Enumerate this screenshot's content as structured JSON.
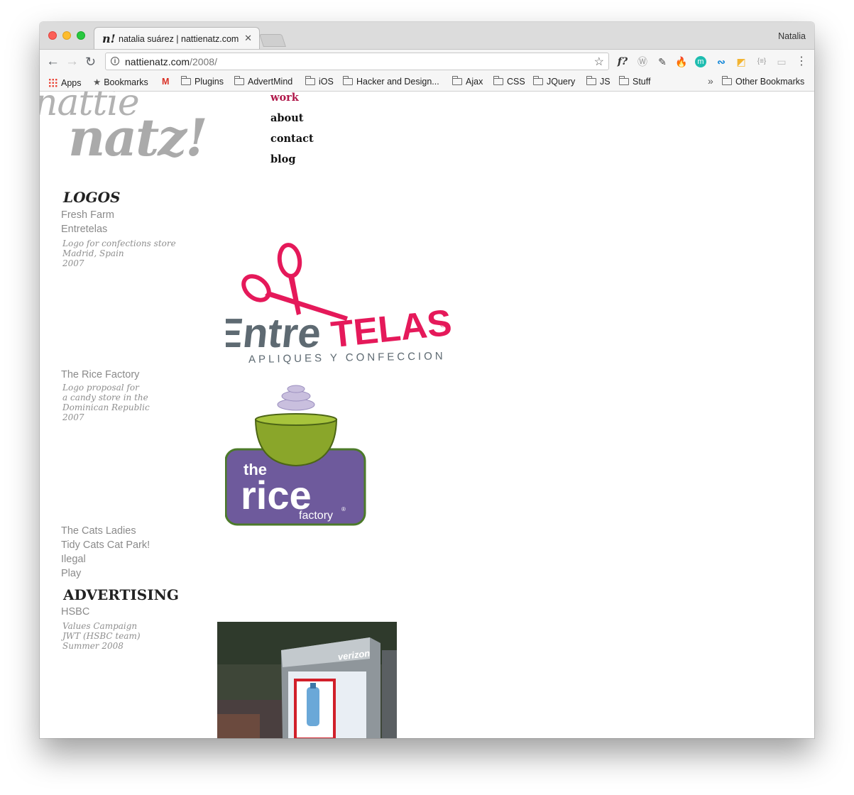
{
  "browser": {
    "tab_favicon": "n!",
    "tab_title": "natalia suárez | nattienatz.com",
    "tab_close": "✕",
    "profile_name": "Natalia",
    "url_host": "nattienatz.com",
    "url_path": "/2008/",
    "info_icon": "i",
    "star_icon": "☆",
    "back_icon": "←",
    "forward_icon": "→",
    "reload_icon": "↻",
    "extensions": [
      {
        "name": "whatfont-icon",
        "glyph": "f?"
      },
      {
        "name": "wordpress-icon",
        "glyph": "Ⓦ"
      },
      {
        "name": "eyedropper-icon",
        "glyph": "✎"
      },
      {
        "name": "fire-icon",
        "glyph": "🔥"
      },
      {
        "name": "m-extension-icon",
        "glyph": "m"
      },
      {
        "name": "wave-icon",
        "glyph": "∾"
      },
      {
        "name": "highlighter-icon",
        "glyph": "◩"
      },
      {
        "name": "json-icon",
        "glyph": "{≡}"
      },
      {
        "name": "toggle-icon",
        "glyph": "▭"
      },
      {
        "name": "menu-icon",
        "glyph": "⋮"
      }
    ]
  },
  "bookmarks": {
    "apps": "Apps",
    "bookmarks": "Bookmarks",
    "gmail": "M",
    "folders": [
      "Plugins",
      "AdvertMind",
      "iOS",
      "Hacker and Design...",
      "Ajax",
      "CSS",
      "JQuery",
      "JS",
      "Stuff"
    ],
    "overflow": "»",
    "other": "Other Bookmarks"
  },
  "site": {
    "logo_line1": "nattie",
    "logo_line2": "natz!",
    "nav": [
      "work",
      "about",
      "contact",
      "blog"
    ],
    "sections": {
      "logos_title": "LOGOS",
      "advertising_title": "ADVERTISING"
    },
    "logos_items": {
      "fresh_farm": "Fresh Farm",
      "entretelas": "Entretelas",
      "entretelas_desc": [
        "Logo for confections store",
        "Madrid, Spain",
        "2007"
      ],
      "rice_factory": "The Rice Factory",
      "rice_desc": [
        "Logo proposal for",
        "a candy store in the",
        "Dominican Republic",
        "2007"
      ],
      "cats_ladies": "The Cats Ladies",
      "tidy_cats": "Tidy Cats Cat Park!",
      "ilegal": "Ilegal",
      "play": "Play"
    },
    "advertising_items": {
      "hsbc": "HSBC",
      "hsbc_desc": [
        "Values Campaign",
        "JWT (HSBC team)",
        "Summer 2008"
      ]
    },
    "artwork": {
      "entretelas_word1": "Entre",
      "entretelas_word2": "TELAS",
      "entretelas_tagline": "APLIQUES Y CONFECCION",
      "registered": "®",
      "rice_the": "the",
      "rice_word": "rice",
      "rice_factory": "factory",
      "verizon": "verizon"
    }
  },
  "colors": {
    "accent": "#b0184a",
    "entretelas_pink": "#e5195a",
    "entretelas_gray": "#5e6a72",
    "rice_purple": "#6e5a9c",
    "rice_green": "#8aa62a"
  }
}
